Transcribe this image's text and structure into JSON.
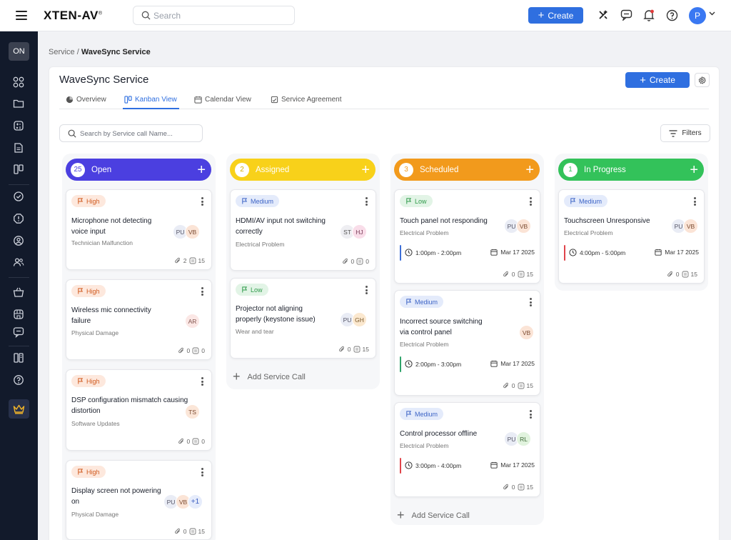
{
  "topbar": {
    "logo": "XTEN-AV",
    "search_placeholder": "Search",
    "create_label": "Create",
    "avatar_initial": "P"
  },
  "sidebar": {
    "status_badge": "ON"
  },
  "breadcrumb": {
    "parent": "Service",
    "separator": "/",
    "current": "WaveSync Service"
  },
  "page": {
    "title": "WaveSync Service",
    "create_label": "Create",
    "tabs": [
      {
        "label": "Overview"
      },
      {
        "label": "Kanban View"
      },
      {
        "label": "Calendar View"
      },
      {
        "label": "Service Agreement"
      }
    ],
    "search_placeholder": "Search by Service call Name...",
    "filters_label": "Filters"
  },
  "colors": {
    "open": "#4b3fe0",
    "assigned": "#f8d11a",
    "scheduled": "#f29a1c",
    "in_progress": "#33c25a",
    "accent": "#2f6fe0"
  },
  "columns": [
    {
      "name": "Open",
      "count": "25",
      "cards": [
        {
          "priority": "High",
          "title": "Microphone not detecting voice input",
          "category": "Technician Malfunction",
          "avatars": [
            "PU",
            "VB"
          ],
          "attachments": "2",
          "comments": "15"
        },
        {
          "priority": "High",
          "title": "Wireless mic connectivity failure",
          "category": "Physical Damage",
          "avatars": [
            "AR"
          ],
          "attachments": "0",
          "comments": "0"
        },
        {
          "priority": "High",
          "title": "DSP configuration mismatch causing distortion",
          "category": "Software Updates",
          "avatars": [
            "TS"
          ],
          "attachments": "0",
          "comments": "0"
        },
        {
          "priority": "High",
          "title": "Display screen not powering on",
          "category": "Physical Damage",
          "avatars": [
            "PU",
            "VB",
            "+1"
          ],
          "attachments": "0",
          "comments": "15"
        }
      ]
    },
    {
      "name": "Assigned",
      "count": "2",
      "cards": [
        {
          "priority": "Medium",
          "title": "HDMI/AV input not switching correctly",
          "category": "Electrical Problem",
          "avatars": [
            "ST",
            "HJ"
          ],
          "attachments": "0",
          "comments": "0"
        },
        {
          "priority": "Low",
          "title": "Projector not aligning properly (keystone issue)",
          "category": "Wear and tear",
          "avatars": [
            "PU",
            "GH"
          ],
          "attachments": "0",
          "comments": "15"
        }
      ],
      "add_label": "Add Service Call"
    },
    {
      "name": "Scheduled",
      "count": "3",
      "cards": [
        {
          "priority": "Low",
          "title": "Touch panel not responding",
          "category": "Electrical Problem",
          "avatars": [
            "PU",
            "VB"
          ],
          "time": "1:00pm - 2:00pm",
          "date": "Mar 17 2025",
          "attachments": "0",
          "comments": "15"
        },
        {
          "priority": "Medium",
          "title": "Incorrect source switching via control panel",
          "category": "Electrical Problem",
          "avatars": [
            "VB"
          ],
          "time": "2:00pm - 3:00pm",
          "date": "Mar 17 2025",
          "attachments": "0",
          "comments": "15"
        },
        {
          "priority": "Medium",
          "title": "Control processor offline",
          "category": "Electrical Problem",
          "avatars": [
            "PU",
            "RL"
          ],
          "time": "3:00pm - 4:00pm",
          "date": "Mar 17 2025",
          "attachments": "0",
          "comments": "15"
        }
      ],
      "add_label": "Add Service Call"
    },
    {
      "name": "In Progress",
      "count": "1",
      "cards": [
        {
          "priority": "Medium",
          "title": "Touchscreen Unresponsive",
          "category": "Electrical Problem",
          "avatars": [
            "PU",
            "VB"
          ],
          "time": "4:00pm - 5:00pm",
          "date": "Mar 17 2025",
          "attachments": "0",
          "comments": "15"
        }
      ]
    }
  ]
}
